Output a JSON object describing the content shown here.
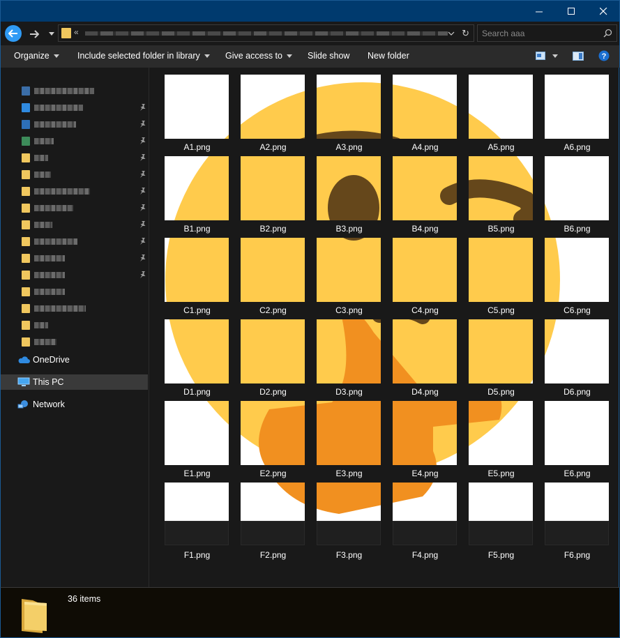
{
  "window": {
    "minimize_glyph": "—",
    "maximize_glyph": "☐",
    "close_glyph": "✕"
  },
  "address": {
    "chevron": "«",
    "path_redacted": true
  },
  "search": {
    "placeholder": "Search aaa"
  },
  "toolbar": {
    "organize": "Organize",
    "include_library": "Include selected folder in library",
    "give_access": "Give access to",
    "slide_show": "Slide show",
    "new_folder": "New folder"
  },
  "sidebar": {
    "quick_access_count": 16,
    "onedrive": "OneDrive",
    "this_pc": "This PC",
    "network": "Network"
  },
  "files": [
    [
      "A1.png",
      "A2.png",
      "A3.png",
      "A4.png",
      "A5.png",
      "A6.png"
    ],
    [
      "B1.png",
      "B2.png",
      "B3.png",
      "B4.png",
      "B5.png",
      "B6.png"
    ],
    [
      "C1.png",
      "C2.png",
      "C3.png",
      "C4.png",
      "C5.png",
      "C6.png"
    ],
    [
      "D1.png",
      "D2.png",
      "D3.png",
      "D4.png",
      "D5.png",
      "D6.png"
    ],
    [
      "E1.png",
      "E2.png",
      "E3.png",
      "E4.png",
      "E5.png",
      "E6.png"
    ],
    [
      "F1.png",
      "F2.png",
      "F3.png",
      "F4.png",
      "F5.png",
      "F6.png"
    ]
  ],
  "status": {
    "item_count": "36 items"
  },
  "colors": {
    "accent": "#2f9bf5",
    "titlebar": "#003a6e",
    "emoji_face": "#ffcb4c",
    "emoji_feature": "#65471b",
    "emoji_hand": "#f19020",
    "folder": "#f0c75e"
  }
}
